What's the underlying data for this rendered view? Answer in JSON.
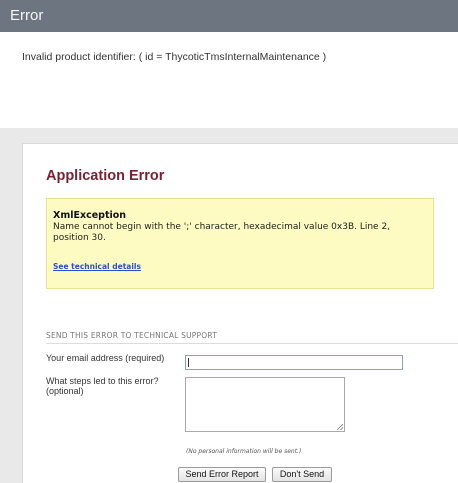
{
  "window": {
    "title": "Error"
  },
  "message": "Invalid product identifier: ( id = ThycoticTmsInternalMaintenance )",
  "panel": {
    "title": "Application Error",
    "error": {
      "exception_name": "XmlException",
      "exception_message": "Name cannot begin with the ';' character, hexadecimal value 0x3B. Line 2, position 30.",
      "technical_link": "See technical details"
    },
    "support": {
      "heading": "SEND THIS ERROR TO TECHNICAL SUPPORT",
      "email_label": "Your email address (required)",
      "email_value": "",
      "steps_label": "What steps led to this error? (optional)",
      "steps_value": "",
      "privacy_note": "(No personal information will be sent.)",
      "send_button": "Send Error Report",
      "dont_send_button": "Don't Send"
    }
  },
  "colors": {
    "titlebar": "#6d7580",
    "heading": "#7a2235",
    "error_box": "#fdfbc1",
    "link": "#2a4fd0"
  }
}
